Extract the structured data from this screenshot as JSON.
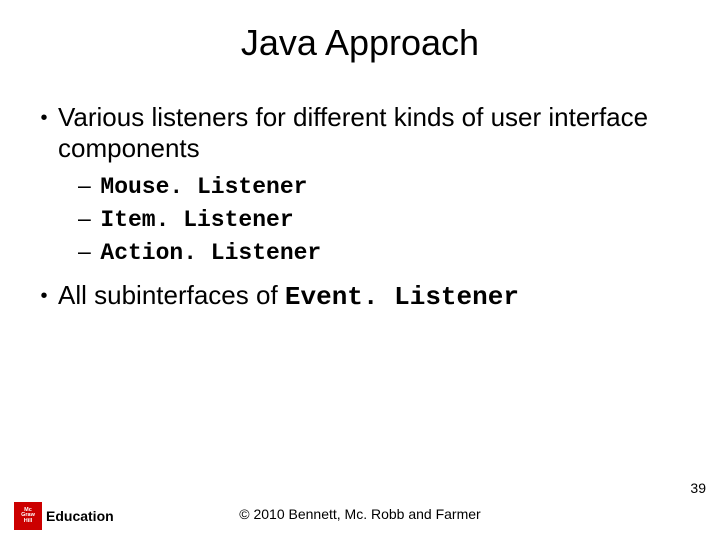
{
  "title": "Java Approach",
  "bullets": {
    "b1": "Various listeners for different kinds of user interface components",
    "sub1": "Mouse. Listener",
    "sub2": "Item. Listener",
    "sub3": "Action. Listener",
    "b2_prefix": "All subinterfaces of ",
    "b2_code": "Event. Listener"
  },
  "footer": {
    "copyright": "© 2010 Bennett, Mc. Robb and Farmer",
    "page": "39",
    "logo_lines": {
      "l1": "Mc",
      "l2": "Graw",
      "l3": "Hill"
    },
    "logo_text": "Education"
  }
}
